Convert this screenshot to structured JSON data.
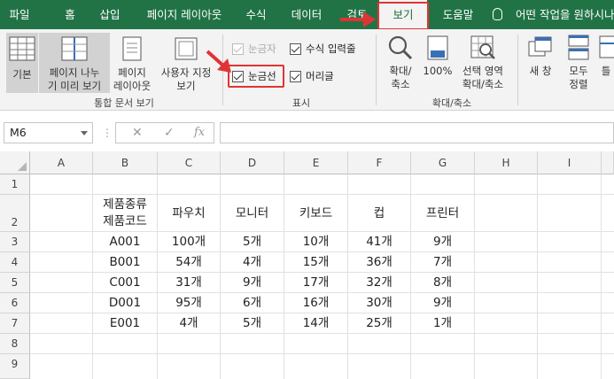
{
  "tabs": [
    "파일",
    "홈",
    "삽입",
    "페이지 레이아웃",
    "수식",
    "데이터",
    "검토",
    "보기",
    "도움말"
  ],
  "tell_me": "어떤 작업을 원하시나",
  "ribbon": {
    "workbook_views": {
      "normal": "기본",
      "page_break_1": "페이지 나누",
      "page_break_2": "기 미리 보기",
      "page_layout_1": "페이지",
      "page_layout_2": "레이아웃",
      "custom_1": "사용자 지정",
      "custom_2": "보기",
      "group": "통합 문서 보기"
    },
    "show": {
      "ruler": "눈금자",
      "formula_bar": "수식 입력줄",
      "gridlines": "눈금선",
      "headings": "머리글",
      "group": "표시"
    },
    "zoom": {
      "zoom_1": "확대/",
      "zoom_2": "축소",
      "zoom100": "100%",
      "zoom_sel_1": "선택 영역",
      "zoom_sel_2": "확대/축소",
      "group": "확대/축소"
    },
    "window": {
      "new_window": "새 창",
      "arrange_1": "모두",
      "arrange_2": "정렬",
      "freeze": "틀"
    }
  },
  "name_box": "M6",
  "formula_icons": {
    "cancel": "✕",
    "enter": "✓",
    "fx": "fx"
  },
  "columns": [
    "A",
    "B",
    "C",
    "D",
    "E",
    "F",
    "G",
    "H",
    "I"
  ],
  "rows": [
    "1",
    "2",
    "3",
    "4",
    "5",
    "6",
    "7",
    "8",
    "9"
  ],
  "table": {
    "header_b_1": "제품종류",
    "header_b_2": "제품코드",
    "headers": [
      "파우치",
      "모니터",
      "키보드",
      "컵",
      "프린터"
    ],
    "data": [
      [
        "A001",
        "100개",
        "5개",
        "10개",
        "41개",
        "9개"
      ],
      [
        "B001",
        "54개",
        "4개",
        "15개",
        "36개",
        "7개"
      ],
      [
        "C001",
        "31개",
        "9개",
        "17개",
        "32개",
        "8개"
      ],
      [
        "D001",
        "95개",
        "6개",
        "16개",
        "30개",
        "9개"
      ],
      [
        "E001",
        "4개",
        "5개",
        "14개",
        "25개",
        "1개"
      ]
    ]
  },
  "colors": {
    "ribbon_green": "#217346",
    "highlight_red": "#e03434"
  }
}
